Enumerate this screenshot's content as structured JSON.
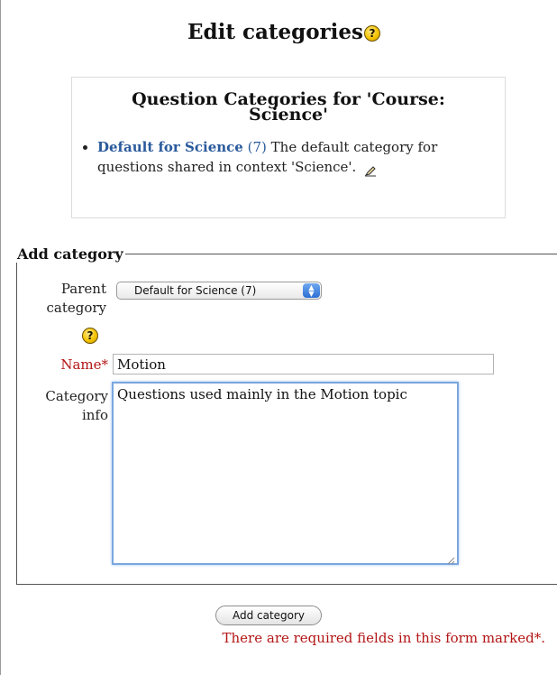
{
  "page": {
    "title": "Edit categories",
    "help_icon_glyph": "?"
  },
  "category_list": {
    "heading": "Question Categories for 'Course: Science'",
    "items": [
      {
        "name": "Default for Science",
        "count": "(7)",
        "description": "The default category for questions shared in context 'Science'.",
        "edit_icon": "edit-icon"
      }
    ]
  },
  "add_form": {
    "legend": "Add category",
    "parent": {
      "label": "Parent category",
      "selected": "Default for Science (7)",
      "help_icon": "help-icon"
    },
    "name": {
      "label": "Name",
      "required_marker": "*",
      "value": "Motion"
    },
    "info": {
      "label": "Category info",
      "value": "Questions used mainly in the Motion topic"
    },
    "submit_label": "Add category",
    "required_note": "There are required fields in this form marked*."
  },
  "colors": {
    "link": "#2a5a9c",
    "required": "#b31515",
    "help_icon": "#f5c400",
    "focus_ring": "#7ba7dd"
  }
}
